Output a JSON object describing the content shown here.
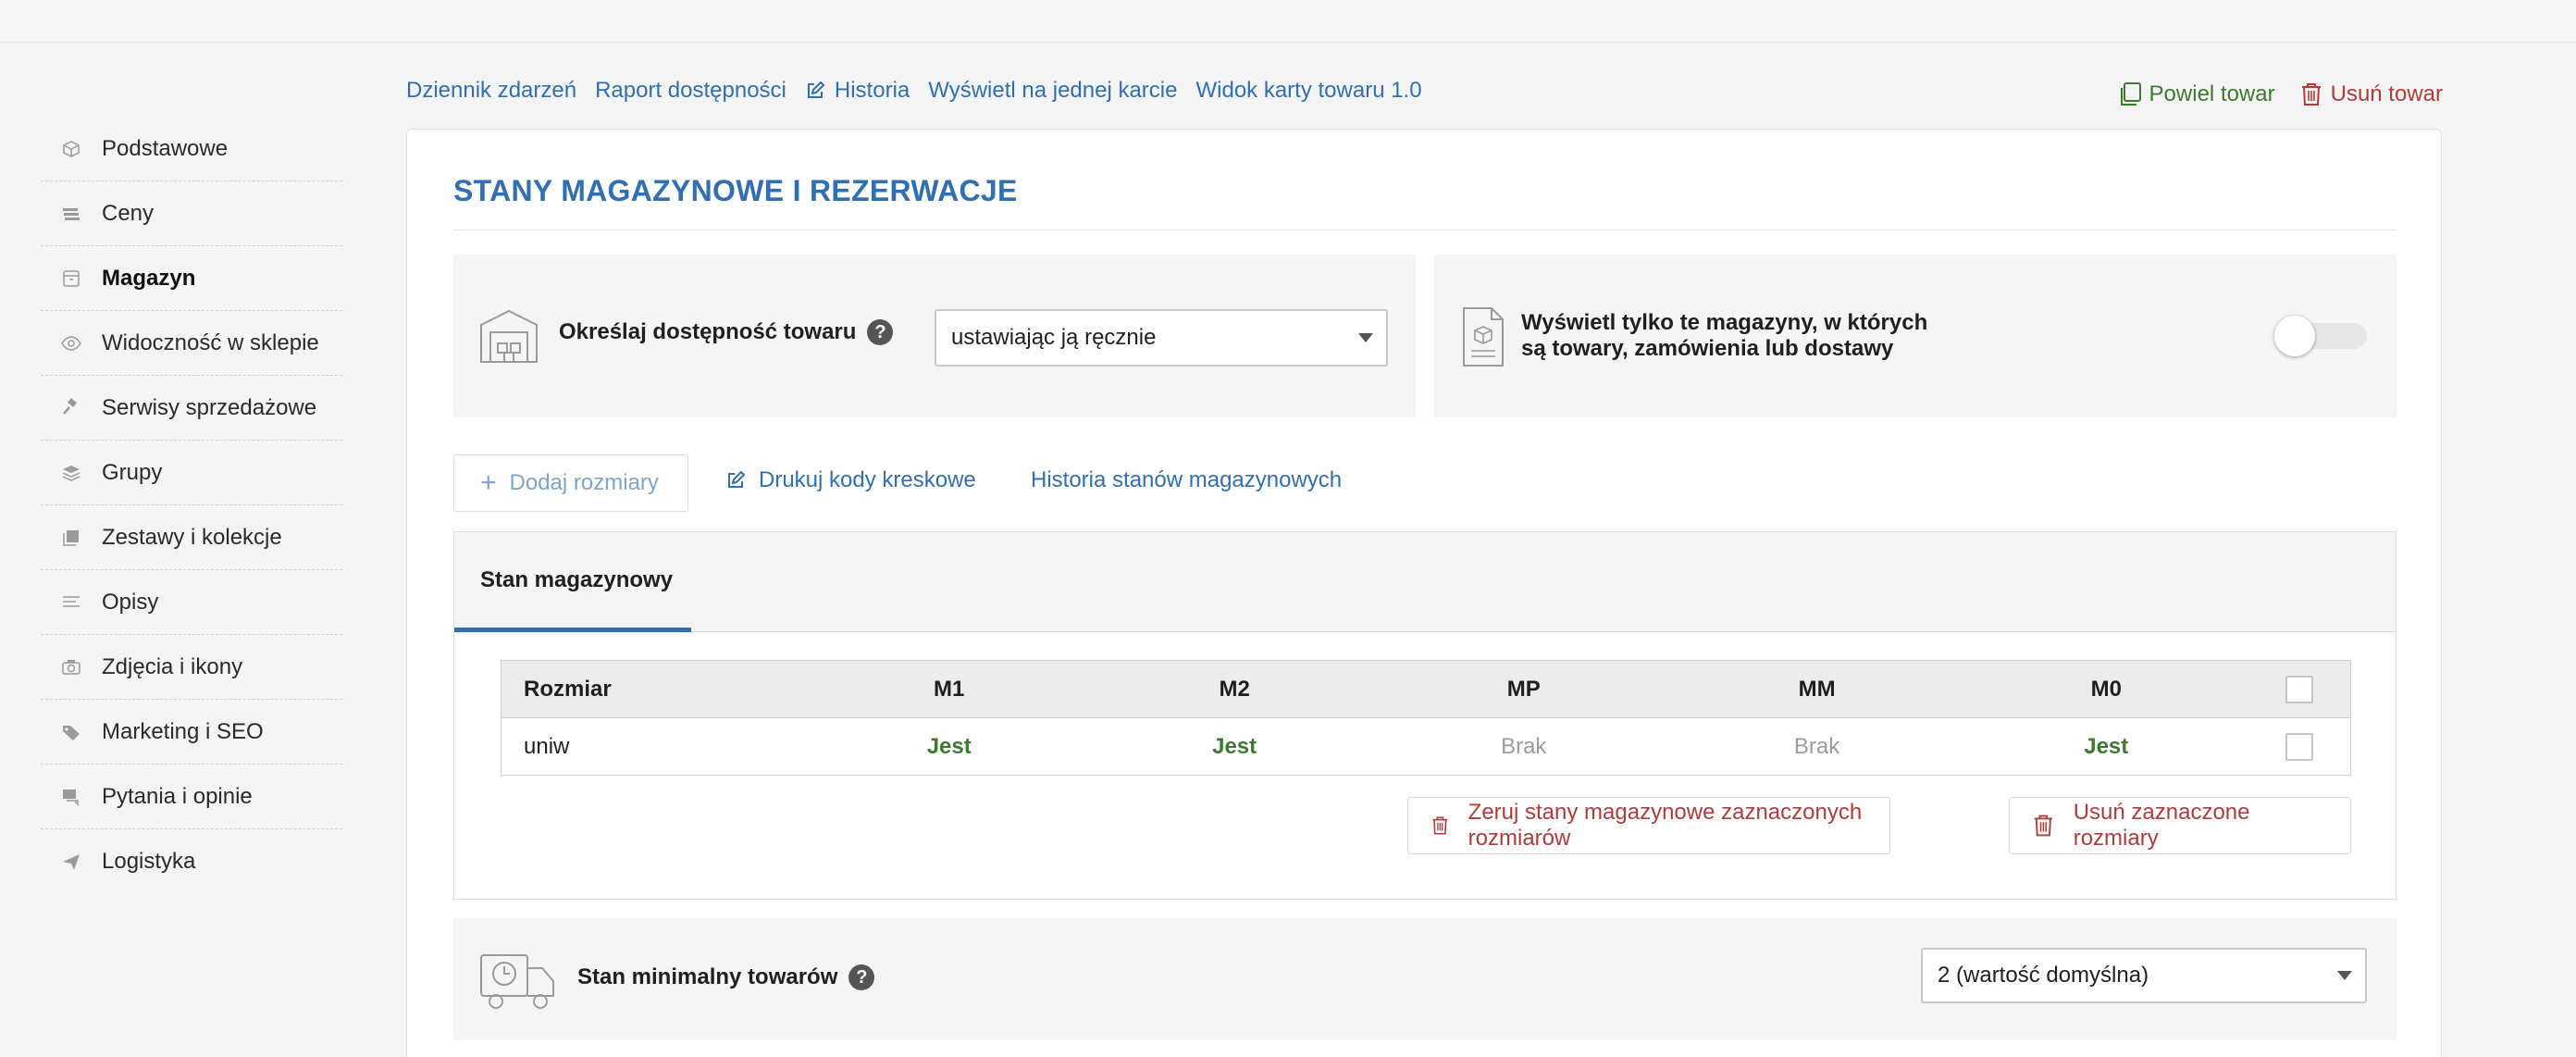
{
  "sidebar": {
    "items": [
      {
        "label": "Podstawowe",
        "icon": "box-icon"
      },
      {
        "label": "Ceny",
        "icon": "banknotes-icon"
      },
      {
        "label": "Magazyn",
        "icon": "warehouse-icon",
        "active": true
      },
      {
        "label": "Widoczność w sklepie",
        "icon": "eye-icon"
      },
      {
        "label": "Serwisy sprzedażowe",
        "icon": "gavel-icon"
      },
      {
        "label": "Grupy",
        "icon": "layers-icon"
      },
      {
        "label": "Zestawy i kolekcje",
        "icon": "collection-icon"
      },
      {
        "label": "Opisy",
        "icon": "text-lines-icon"
      },
      {
        "label": "Zdjęcia i ikony",
        "icon": "camera-icon"
      },
      {
        "label": "Marketing i SEO",
        "icon": "tags-icon"
      },
      {
        "label": "Pytania i opinie",
        "icon": "chat-icon"
      },
      {
        "label": "Logistyka",
        "icon": "paper-plane-icon"
      }
    ]
  },
  "toplinks": {
    "dziennik": "Dziennik zdarzeń",
    "raport": "Raport dostępności",
    "historia": "Historia",
    "wyswietl": "Wyświetl na jednej karcie",
    "widok": "Widok karty towaru 1.0"
  },
  "rightlinks": {
    "powiel": "Powiel towar",
    "usun": "Usuń towar"
  },
  "colors": {
    "accent": "#2f6fb2",
    "green": "#3d7a2e",
    "red": "#b23a3a"
  },
  "section": {
    "title": "STANY MAGAZYNOWE I REZERWACJE"
  },
  "availability": {
    "label": "Określaj dostępność towaru",
    "select_value": "ustawiając ją ręcznie"
  },
  "filter": {
    "label": "Wyświetl tylko te magazyny, w których są towary, zamówienia lub dostawy",
    "toggle_on": false
  },
  "actions": {
    "add_sizes": "Dodaj rozmiary",
    "print_barcodes": "Drukuj kody kreskowe",
    "stock_history": "Historia stanów magazynowych"
  },
  "tabs": [
    {
      "label": "Stan magazynowy",
      "active": true
    }
  ],
  "table": {
    "headers": [
      "Rozmiar",
      "M1",
      "M2",
      "MP",
      "MM",
      "M0"
    ],
    "rows": [
      {
        "size": "uniw",
        "values": [
          "Jest",
          "Jest",
          "Brak",
          "Brak",
          "Jest"
        ]
      }
    ]
  },
  "bulk": {
    "zero_stock": "Zeruj stany magazynowe zaznaczonych rozmiarów",
    "delete_sizes": "Usuń zaznaczone rozmiary"
  },
  "min_stock": {
    "label": "Stan minimalny towarów",
    "select_value": "2 (wartość domyślna)"
  }
}
